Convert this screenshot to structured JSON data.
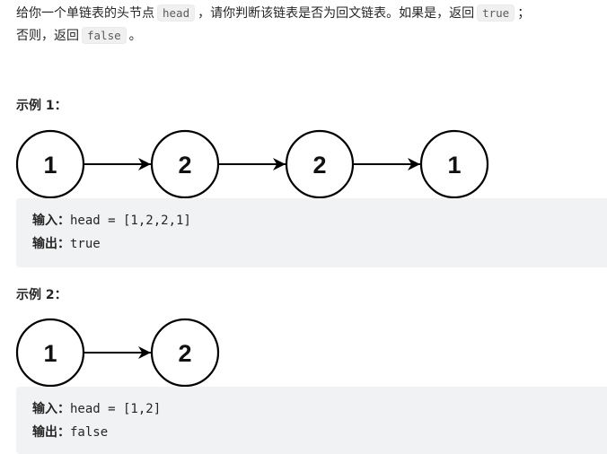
{
  "description": {
    "line1_before": "给你一个单链表的头节点",
    "line1_code1": "head",
    "line1_middle": "，请你判断该链表是否为回文链表。如果是，返回",
    "line1_code2": "true",
    "line1_after": "；",
    "line2_before": "否则，返回",
    "line2_code": "false",
    "line2_after": "。"
  },
  "examples": [
    {
      "title": "示例 1：",
      "nodes": [
        "1",
        "2",
        "2",
        "1"
      ],
      "input_label": "输入：",
      "input_value": "head = [1,2,2,1]",
      "output_label": "输出：",
      "output_value": "true"
    },
    {
      "title": "示例 2：",
      "nodes": [
        "1",
        "2"
      ],
      "input_label": "输入：",
      "input_value": "head = [1,2]",
      "output_label": "输出：",
      "output_value": "false"
    }
  ]
}
